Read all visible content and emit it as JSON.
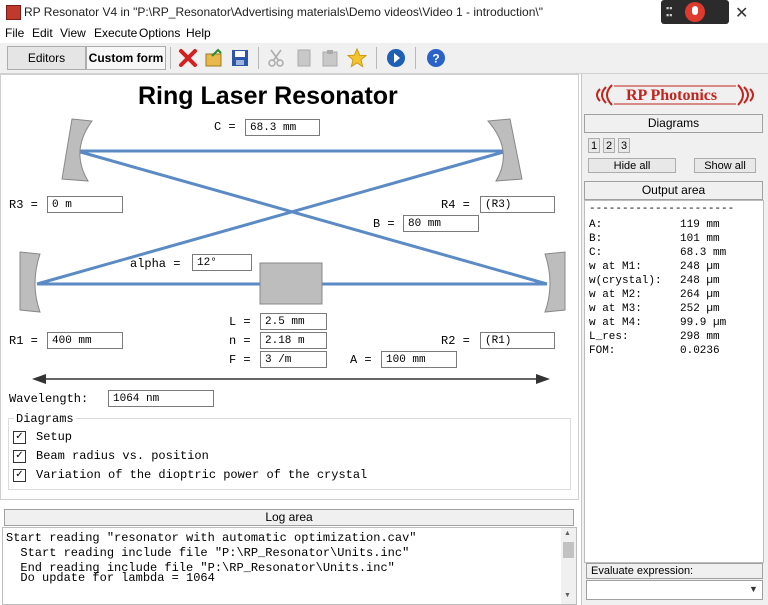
{
  "window": {
    "title": "RP Resonator V4 in \"P:\\RP_Resonator\\Advertising materials\\Demo videos\\Video 1 - introduction\\\""
  },
  "menu": [
    "File",
    "Edit",
    "View",
    "Execute",
    "Options",
    "Help"
  ],
  "toolbar": {
    "editors_label": "Editors",
    "custom_form_label": "Custom form",
    "icons": [
      "close-file-icon",
      "open-file-icon",
      "save-icon",
      "cut-icon",
      "copy-icon",
      "paste-icon",
      "star-icon",
      "run-icon",
      "help-icon"
    ]
  },
  "form": {
    "title": "Ring Laser Resonator",
    "fields": {
      "C": {
        "label": "C =",
        "value": "68.3 mm"
      },
      "R3": {
        "label": "R3 =",
        "value": "0 m"
      },
      "R4": {
        "label": "R4 =",
        "value": "(R3)"
      },
      "B": {
        "label": "B =",
        "value": "80 mm"
      },
      "alpha": {
        "label": "alpha =",
        "value": "12°"
      },
      "R1": {
        "label": "R1 =",
        "value": "400 mm"
      },
      "R2": {
        "label": "R2 =",
        "value": "(R1)"
      },
      "L": {
        "label": "L =",
        "value": "2.5 mm"
      },
      "n": {
        "label": "n =",
        "value": "2.18 m"
      },
      "F": {
        "label": "F =",
        "value": "3 /m"
      },
      "A": {
        "label": "A =",
        "value": "100 mm"
      },
      "wavelength": {
        "label": "Wavelength:",
        "value": "1064 nm"
      }
    },
    "diagrams": {
      "title": "Diagrams",
      "items": [
        {
          "label": "Setup",
          "checked": true
        },
        {
          "label": "Beam radius vs. position",
          "checked": true
        },
        {
          "label": "Variation of the dioptric power of the crystal",
          "checked": true
        }
      ]
    },
    "colors": {
      "beam": "#5b8ac5",
      "mirror": "#b8b8b8",
      "crystal": "#bdbdbd"
    }
  },
  "log": {
    "title": "Log area",
    "lines": [
      "Start reading \"resonator with automatic optimization.cav\"",
      "  Start reading include file \"P:\\RP_Resonator\\Units.inc\"",
      "  End reading include file \"P:\\RP_Resonator\\Units.inc\"",
      "",
      "  Do update for lambda = 1064"
    ]
  },
  "right": {
    "logo_text": "RP Photonics",
    "diagrams_header": "Diagrams",
    "diagram_buttons": [
      "1",
      "2",
      "3"
    ],
    "hide_all": "Hide all",
    "show_all": "Show all",
    "output_header": "Output area",
    "output_rule": "----------------------",
    "output": [
      {
        "k": "A:",
        "v": "119 mm"
      },
      {
        "k": "B:",
        "v": "101 mm"
      },
      {
        "k": "C:",
        "v": "68.3 mm"
      },
      {
        "k": "w at M1:",
        "v": "248 µm"
      },
      {
        "k": "w(crystal):",
        "v": "248 µm"
      },
      {
        "k": "w at M2:",
        "v": "264 µm"
      },
      {
        "k": "w at M3:",
        "v": "252 µm"
      },
      {
        "k": "w at M4:",
        "v": "99.9 µm"
      },
      {
        "k": "L_res:",
        "v": "298 mm"
      },
      {
        "k": "FOM:",
        "v": "0.0236"
      }
    ],
    "evaluate_label": "Evaluate expression:"
  }
}
